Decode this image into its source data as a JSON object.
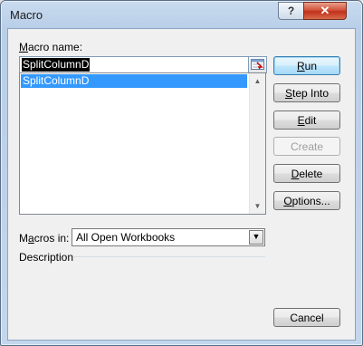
{
  "window": {
    "title": "Macro",
    "help_glyph": "?",
    "close_glyph": "✕"
  },
  "macro_name": {
    "label_underlined": "M",
    "label_rest": "acro name:",
    "value": "SplitColumnD"
  },
  "macro_list": {
    "items": [
      "SplitColumnD"
    ],
    "selected": "SplitColumnD"
  },
  "buttons": {
    "run": {
      "u": "R",
      "rest": "un"
    },
    "step_into": {
      "u": "S",
      "rest": "tep Into"
    },
    "edit": {
      "u": "E",
      "rest": "dit"
    },
    "create": {
      "label": "Create"
    },
    "delete": {
      "u": "D",
      "rest": "elete"
    },
    "options": {
      "u": "O",
      "rest": "ptions..."
    },
    "cancel": {
      "label": "Cancel"
    }
  },
  "macros_in": {
    "label_pre": "M",
    "label_u": "a",
    "label_post": "cros in:",
    "value": "All Open Workbooks"
  },
  "description": {
    "label": "Description",
    "text": ""
  },
  "colors": {
    "accent": "#3399ff",
    "close": "#c0301a",
    "default_button_border": "#3c7fb1"
  }
}
